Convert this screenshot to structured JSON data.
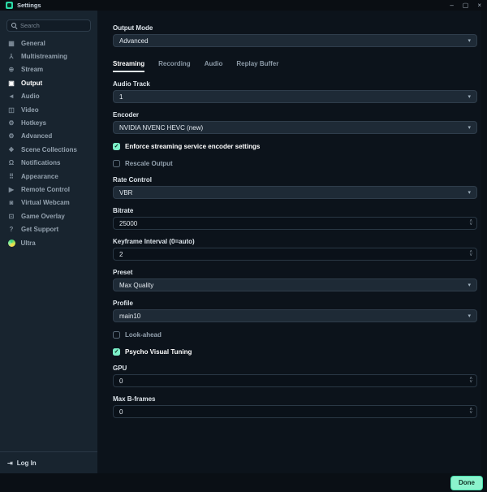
{
  "window": {
    "title": "Settings"
  },
  "icons": {
    "caret": "▾",
    "spin_up": "˄",
    "spin_down": "˅",
    "check": "✓",
    "minimize": "–",
    "maximize": "▢",
    "close": "×",
    "login": "⇥",
    "general": "▦",
    "multistreaming": "⅄",
    "stream": "⊕",
    "output": "▣",
    "audio": "◄",
    "video": "◫",
    "hotkeys": "⚙",
    "advanced": "⚙",
    "scene_collections": "❖",
    "notifications": "Ω",
    "appearance": "⠿",
    "remote_control": "▶",
    "virtual_webcam": "◙",
    "game_overlay": "⊡",
    "get_support": "?"
  },
  "sidebar": {
    "search_placeholder": "Search",
    "items": [
      {
        "label": "General"
      },
      {
        "label": "Multistreaming"
      },
      {
        "label": "Stream"
      },
      {
        "label": "Output",
        "active": true
      },
      {
        "label": "Audio"
      },
      {
        "label": "Video"
      },
      {
        "label": "Hotkeys"
      },
      {
        "label": "Advanced"
      },
      {
        "label": "Scene Collections"
      },
      {
        "label": "Notifications"
      },
      {
        "label": "Appearance"
      },
      {
        "label": "Remote Control"
      },
      {
        "label": "Virtual Webcam"
      },
      {
        "label": "Game Overlay"
      },
      {
        "label": "Get Support"
      },
      {
        "label": "Ultra"
      }
    ],
    "login_label": "Log In"
  },
  "content": {
    "output_mode": {
      "label": "Output Mode",
      "value": "Advanced"
    },
    "tabs": [
      {
        "label": "Streaming",
        "active": true
      },
      {
        "label": "Recording",
        "active": false
      },
      {
        "label": "Audio",
        "active": false
      },
      {
        "label": "Replay Buffer",
        "active": false
      }
    ],
    "audio_track": {
      "label": "Audio Track",
      "value": "1"
    },
    "encoder": {
      "label": "Encoder",
      "value": "NVIDIA NVENC HEVC (new)"
    },
    "enforce": {
      "label": "Enforce streaming service encoder settings",
      "checked": true
    },
    "rescale": {
      "label": "Rescale Output",
      "checked": false
    },
    "rate_control": {
      "label": "Rate Control",
      "value": "VBR"
    },
    "bitrate": {
      "label": "Bitrate",
      "value": "25000"
    },
    "keyframe": {
      "label": "Keyframe Interval (0=auto)",
      "value": "2"
    },
    "preset": {
      "label": "Preset",
      "value": "Max Quality"
    },
    "profile": {
      "label": "Profile",
      "value": "main10"
    },
    "lookahead": {
      "label": "Look-ahead",
      "checked": false
    },
    "psycho": {
      "label": "Psycho Visual Tuning",
      "checked": true
    },
    "gpu": {
      "label": "GPU",
      "value": "0"
    },
    "max_bframes": {
      "label": "Max B-frames",
      "value": "0"
    }
  },
  "footer": {
    "done_label": "Done"
  },
  "colors": {
    "accent_mint": "#7df0c9",
    "done_button_bg": "#8bf3cd",
    "sidebar_bg": "#18242f",
    "content_bg": "#0c131b",
    "titlebar_bg": "#0a0e13",
    "control_bg": "#1e2a36",
    "active_text": "#ffffff"
  }
}
